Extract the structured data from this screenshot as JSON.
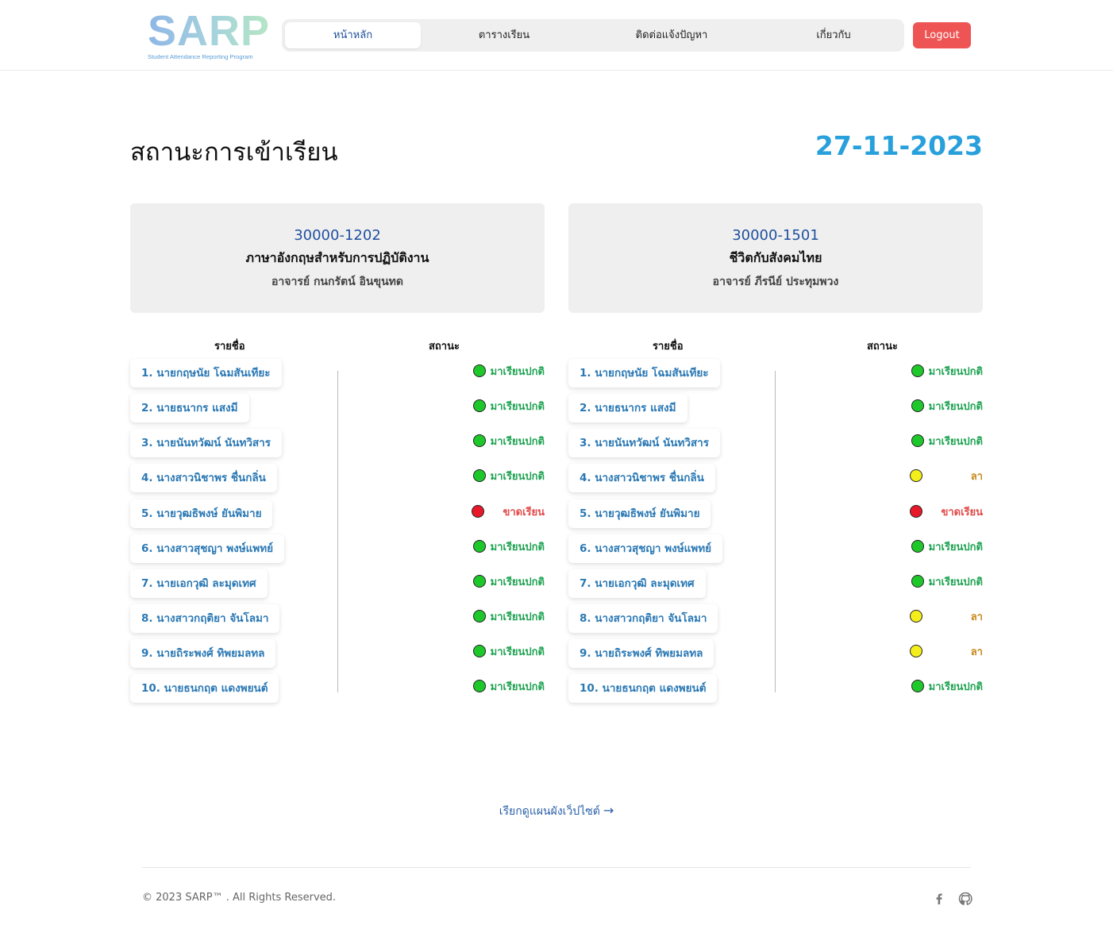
{
  "brand": {
    "logo_text": "SARP",
    "logo_sub": "Student Attendance Reporting Program"
  },
  "nav": {
    "items": [
      {
        "label": "หน้าหลัก",
        "active": true
      },
      {
        "label": "ตารางเรียน",
        "active": false
      },
      {
        "label": "ติดต่อแจ้งปัญหา",
        "active": false
      },
      {
        "label": "เกี่ยวกับ",
        "active": false
      }
    ],
    "logout_label": "Logout"
  },
  "page": {
    "title": "สถานะการเข้าเรียน",
    "date": "27-11-2023"
  },
  "colors": {
    "present": "#1fa352",
    "leave": "#c78a1b",
    "absent": "#e24b4b",
    "dot_present": "#1ec82b",
    "dot_leave": "#f4ee1b",
    "dot_absent": "#e8182b",
    "accent": "#27a0dc",
    "logout": "#ee5454"
  },
  "courses": [
    {
      "code": "30000-1202",
      "name": "ภาษาอังกฤษสำหรับการปฏิบัติงาน",
      "teacher": "อาจารย์  กนกรัตน์ อินขุนทด",
      "col_name": "รายชื่อ",
      "col_status": "สถานะ",
      "students": [
        {
          "name": "1. นายกฤษนัย โฉมสันเทียะ",
          "status": "มาเรียนปกติ",
          "state": "present"
        },
        {
          "name": "2. นายธนากร แสงมี",
          "status": "มาเรียนปกติ",
          "state": "present"
        },
        {
          "name": "3. นายนันทวัฒน์ นันทวิสาร",
          "status": "มาเรียนปกติ",
          "state": "present"
        },
        {
          "name": "4. นางสาวนิชาพร ชื่นกลิ่น",
          "status": "มาเรียนปกติ",
          "state": "present"
        },
        {
          "name": "5. นายวุฒธิพงษ์ ยันพิมาย",
          "status": "ขาดเรียน",
          "state": "absent"
        },
        {
          "name": "6. นางสาวสุชญา พงษ์แพทย์",
          "status": "มาเรียนปกติ",
          "state": "present"
        },
        {
          "name": "7. นายเอกวุฒิ ละมุดเทศ",
          "status": "มาเรียนปกติ",
          "state": "present"
        },
        {
          "name": "8. นางสาวกฤติยา จันโลมา",
          "status": "มาเรียนปกติ",
          "state": "present"
        },
        {
          "name": "9. นายถิระพงศ์ ทิพยมลทล",
          "status": "มาเรียนปกติ",
          "state": "present"
        },
        {
          "name": "10. นายธนกฤต แดงพยนต์",
          "status": "มาเรียนปกติ",
          "state": "present"
        }
      ]
    },
    {
      "code": "30000-1501",
      "name": "ชีวิตกับสังคมไทย",
      "teacher": "อาจารย์  ภีรนีย์ ประทุมพวง",
      "col_name": "รายชื่อ",
      "col_status": "สถานะ",
      "students": [
        {
          "name": "1. นายกฤษนัย โฉมสันเทียะ",
          "status": "มาเรียนปกติ",
          "state": "present"
        },
        {
          "name": "2. นายธนากร แสงมี",
          "status": "มาเรียนปกติ",
          "state": "present"
        },
        {
          "name": "3. นายนันทวัฒน์ นันทวิสาร",
          "status": "มาเรียนปกติ",
          "state": "present"
        },
        {
          "name": "4. นางสาวนิชาพร ชื่นกลิ่น",
          "status": "ลา",
          "state": "leave"
        },
        {
          "name": "5. นายวุฒธิพงษ์ ยันพิมาย",
          "status": "ขาดเรียน",
          "state": "absent"
        },
        {
          "name": "6. นางสาวสุชญา พงษ์แพทย์",
          "status": "มาเรียนปกติ",
          "state": "present"
        },
        {
          "name": "7. นายเอกวุฒิ ละมุดเทศ",
          "status": "มาเรียนปกติ",
          "state": "present"
        },
        {
          "name": "8. นางสาวกฤติยา จันโลมา",
          "status": "ลา",
          "state": "leave"
        },
        {
          "name": "9. นายถิระพงศ์ ทิพยมลทล",
          "status": "ลา",
          "state": "leave"
        },
        {
          "name": "10. นายธนกฤต แดงพยนต์",
          "status": "มาเรียนปกติ",
          "state": "present"
        }
      ]
    }
  ],
  "footer": {
    "sitemap_label": "เรียกดูแผนผังเว็ปไซต์",
    "copyright": "© 2023 SARP™ . All Rights Reserved.",
    "social": [
      "facebook-icon",
      "github-icon"
    ]
  }
}
